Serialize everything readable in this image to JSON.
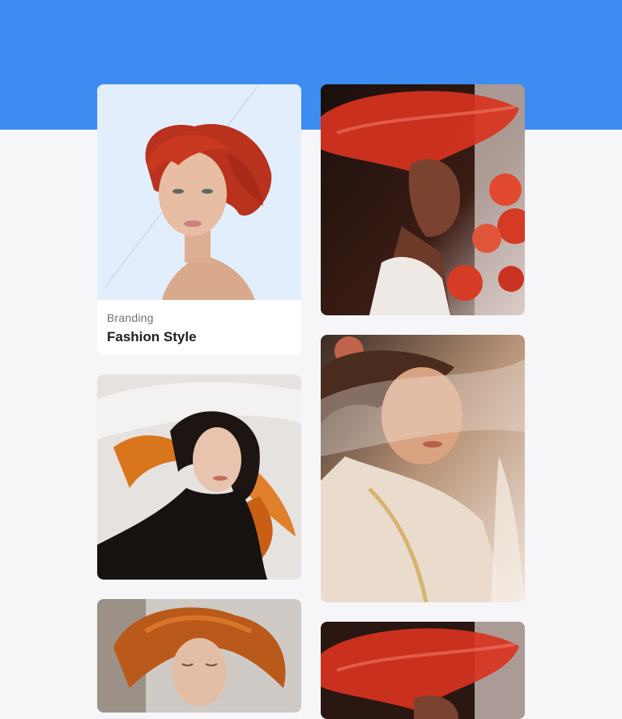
{
  "hero": {
    "background_color": "#3d8cf2"
  },
  "gallery": {
    "featured": {
      "category": "Branding",
      "title": "Fashion Style",
      "image_alt": "Portrait of a woman with short red hair"
    },
    "items": [
      {
        "image_alt": "Woman in a large red hat holding red roses"
      },
      {
        "image_alt": "Woman with windswept dark and orange hair"
      },
      {
        "image_alt": "Woman with eyes closed under a sheer veil"
      },
      {
        "image_alt": "Woman with flowing copper hair"
      },
      {
        "image_alt": "Woman in a large red hat"
      }
    ]
  }
}
